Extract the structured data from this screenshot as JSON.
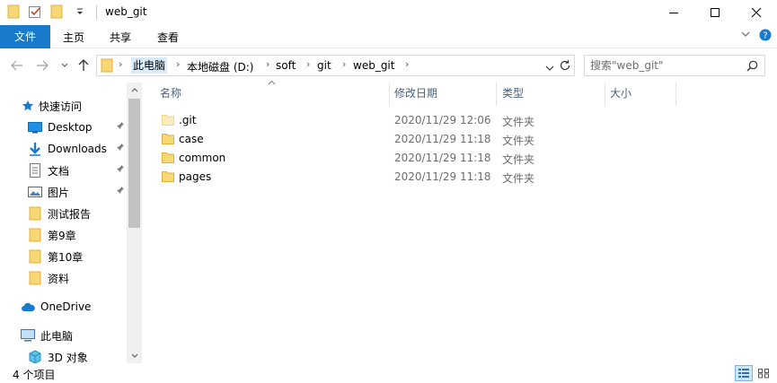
{
  "window": {
    "title": "web_git"
  },
  "ribbon": {
    "tabs": [
      "文件",
      "主页",
      "共享",
      "查看"
    ]
  },
  "address": {
    "crumbs": [
      "此电脑",
      "本地磁盘 (D:)",
      "soft",
      "git",
      "web_git"
    ]
  },
  "search": {
    "placeholder": "搜索\"web_git\""
  },
  "nav": {
    "quick_access": "快速访问",
    "items": [
      {
        "label": "Desktop",
        "icon": "desktop-icon",
        "pinned": true
      },
      {
        "label": "Downloads",
        "icon": "download-icon",
        "pinned": true
      },
      {
        "label": "文档",
        "icon": "document-icon",
        "pinned": true
      },
      {
        "label": "图片",
        "icon": "picture-icon",
        "pinned": true
      },
      {
        "label": "测试报告",
        "icon": "folder-icon",
        "pinned": false
      },
      {
        "label": "第9章",
        "icon": "folder-icon",
        "pinned": false
      },
      {
        "label": "第10章",
        "icon": "folder-icon",
        "pinned": false
      },
      {
        "label": "资料",
        "icon": "folder-icon",
        "pinned": false
      }
    ],
    "onedrive": "OneDrive",
    "this_pc": "此电脑",
    "objects_3d": "3D 对象"
  },
  "columns": {
    "name": "名称",
    "modified": "修改日期",
    "type": "类型",
    "size": "大小"
  },
  "files": [
    {
      "name": ".git",
      "modified": "2020/11/29 12:06",
      "type": "文件夹",
      "hidden": true
    },
    {
      "name": "case",
      "modified": "2020/11/29 11:18",
      "type": "文件夹",
      "hidden": false
    },
    {
      "name": "common",
      "modified": "2020/11/29 11:18",
      "type": "文件夹",
      "hidden": false
    },
    {
      "name": "pages",
      "modified": "2020/11/29 11:18",
      "type": "文件夹",
      "hidden": false
    }
  ],
  "status": {
    "item_count": "4 个项目"
  },
  "colors": {
    "accent": "#1979ca",
    "folder": "#f8d775",
    "folder_dark": "#e8b84a",
    "folder_hidden": "#fbecc0",
    "header_text": "#4c607a"
  }
}
